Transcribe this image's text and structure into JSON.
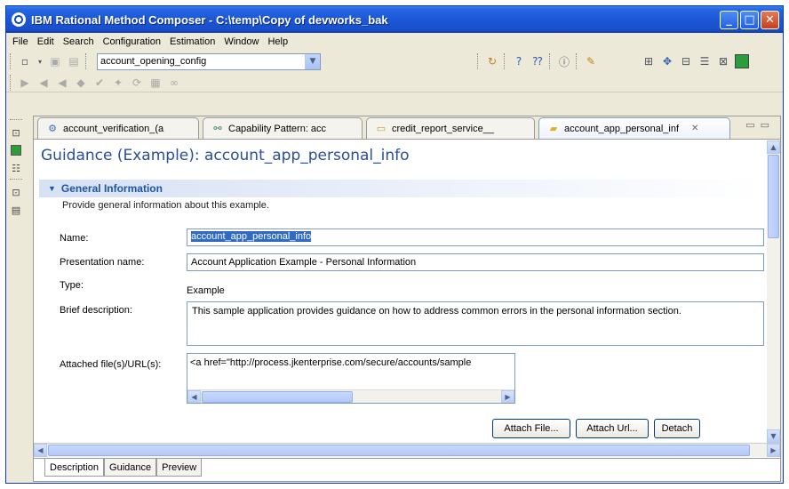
{
  "window": {
    "title": "IBM Rational Method Composer - C:\\temp\\Copy of devworks_bak"
  },
  "menu": [
    "File",
    "Edit",
    "Search",
    "Configuration",
    "Estimation",
    "Window",
    "Help"
  ],
  "toolbar": {
    "configuration": "account_opening_config"
  },
  "editor_tabs": [
    {
      "label": "account_verification_(a",
      "icon": "delivery-process-icon"
    },
    {
      "label": "Capability Pattern: acc",
      "icon": "capability-pattern-icon"
    },
    {
      "label": "credit_report_service__",
      "icon": "task-icon"
    },
    {
      "label": "account_app_personal_inf",
      "icon": "guidance-icon",
      "active": true,
      "close": "✕"
    }
  ],
  "page": {
    "title": "Guidance (Example): account_app_personal_info"
  },
  "section": {
    "title": "General Information",
    "description": "Provide general information about this example."
  },
  "fields": {
    "name_label": "Name:",
    "name_value": "account_app_personal_info",
    "presentation_label": "Presentation name:",
    "presentation_value": "Account Application Example - Personal Information",
    "type_label": "Type:",
    "type_value": "Example",
    "brief_label": "Brief description:",
    "brief_value": "This sample application provides guidance on how to address common errors in the personal information section.",
    "attached_label": "Attached file(s)/URL(s):",
    "attached_value": "<a href=\"http://process.jkenterprise.com/secure/accounts/sample"
  },
  "buttons": {
    "attach_file": "Attach File...",
    "attach_url": "Attach Url...",
    "detach": "Detach"
  },
  "bottom_tabs": [
    "Description",
    "Guidance",
    "Preview"
  ]
}
